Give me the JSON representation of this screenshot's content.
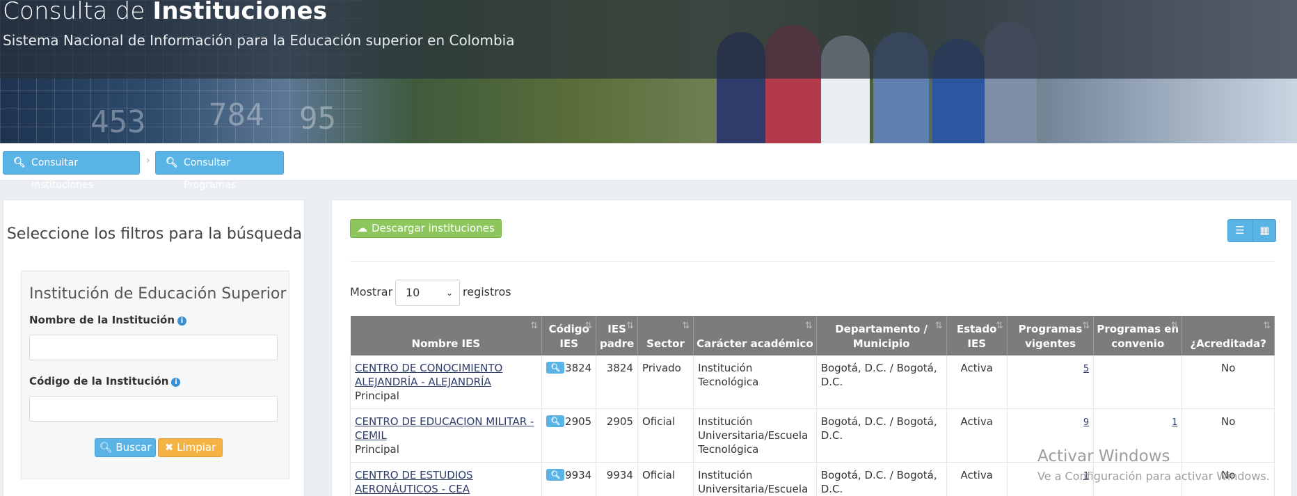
{
  "header": {
    "title_light": "Consulta de",
    "title_bold": "Instituciones",
    "subtitle": "Sistema Nacional de Información para la Educación superior en Colombia"
  },
  "breadcrumb": {
    "items": [
      "Consultar Instituciones",
      "Consultar Programas"
    ],
    "separator": "›"
  },
  "filters": {
    "heading": "Seleccione los filtros para la búsqueda",
    "section_title": "Institución de Educación Superior",
    "name_label": "Nombre de la Institución",
    "code_label": "Código de la Institución",
    "name_value": "",
    "code_value": "",
    "search_label": "Buscar",
    "clear_label": "Limpiar"
  },
  "results": {
    "download_label": "Descargar instituciones",
    "show_label": "Mostrar",
    "page_size": "10",
    "records_label": "registros",
    "columns": [
      "Nombre IES",
      "Código IES",
      "IES padre",
      "Sector",
      "Carácter académico",
      "Departamento / Municipio",
      "Estado IES",
      "Programas vigentes",
      "Programas en convenio",
      "¿Acreditada?"
    ],
    "rows": [
      {
        "name": "CENTRO DE CONOCIMIENTO ALEJANDRÍA - ALEJANDRÍA",
        "type": "Principal",
        "code": "3824",
        "parent": "3824",
        "sector": "Privado",
        "character": "Institución Tecnológica",
        "location": "Bogotá, D.C. / Bogotá, D.C.",
        "status": "Activa",
        "programs": "5",
        "agreements": "",
        "accredited": "No"
      },
      {
        "name": "CENTRO DE EDUCACION MILITAR - CEMIL",
        "type": "Principal",
        "code": "2905",
        "parent": "2905",
        "sector": "Oficial",
        "character": "Institución Universitaria/Escuela Tecnológica",
        "location": "Bogotá, D.C. / Bogotá, D.C.",
        "status": "Activa",
        "programs": "9",
        "agreements": "1",
        "accredited": "No"
      },
      {
        "name": "CENTRO DE ESTUDIOS AERONÁUTICOS - CEA",
        "type": "",
        "code": "9934",
        "parent": "9934",
        "sector": "Oficial",
        "character": "Institución Universitaria/Escuela",
        "location": "Bogotá, D.C. / Bogotá, D.C.",
        "status": "Activa",
        "programs": "1",
        "agreements": "",
        "accredited": "No"
      }
    ]
  },
  "watermark": {
    "line1": "Activar Windows",
    "line2": "Ve a Configuración para activar Windows."
  },
  "icons": {
    "search": "search-icon",
    "cloud_download": "cloud-download-icon",
    "list_view": "list-view-icon",
    "grid_view": "grid-view-icon",
    "info": "info-icon",
    "clear": "x-icon"
  }
}
